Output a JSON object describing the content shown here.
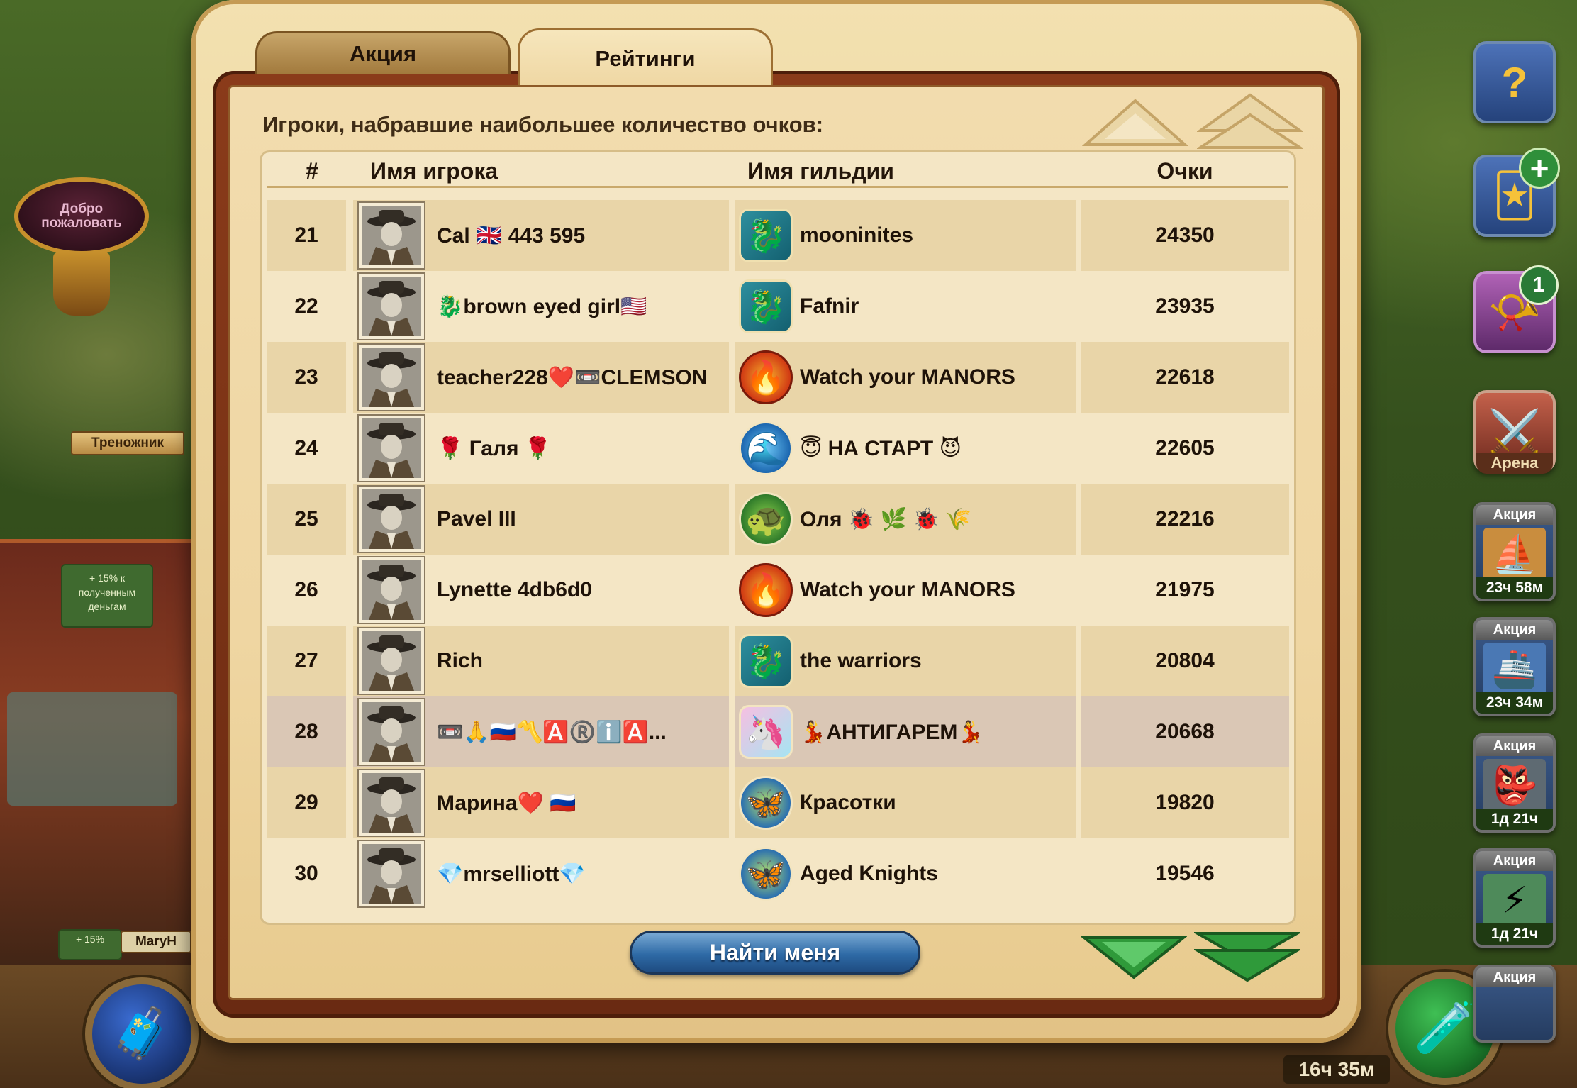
{
  "tabs": [
    {
      "label": "Акция",
      "active": false
    },
    {
      "label": "Рейтинги",
      "active": true
    }
  ],
  "header": "Игроки, набравшие наибольшее количество очков:",
  "columns": {
    "rank": "#",
    "player": "Имя игрока",
    "guild": "Имя гильдии",
    "points": "Очки"
  },
  "rows": [
    {
      "rank": "21",
      "player": "Cal 🇬🇧 443 595",
      "guild": "mooninites",
      "guild_icon": "dragon-emblem-icon",
      "points": "24350"
    },
    {
      "rank": "22",
      "player": "🐉brown eyed girl🇺🇸",
      "guild": "Fafnir",
      "guild_icon": "dragon-emblem-icon",
      "points": "23935"
    },
    {
      "rank": "23",
      "player": "teacher228❤️📼CLEMSON",
      "guild": "Watch your MANORS",
      "guild_icon": "phoenix-emblem-icon",
      "points": "22618"
    },
    {
      "rank": "24",
      "player": "🌹 Галя 🌹",
      "guild": "😇 НА СТАРТ 😈",
      "guild_icon": "wave-emblem-icon",
      "points": "22605"
    },
    {
      "rank": "25",
      "player": "Pavel III",
      "guild": "Оля 🐞 🌿 🐞 🌾",
      "guild_icon": "turtle-emblem-icon",
      "points": "22216"
    },
    {
      "rank": "26",
      "player": "Lynette 4db6d0",
      "guild": "Watch your MANORS",
      "guild_icon": "phoenix-emblem-icon",
      "points": "21975"
    },
    {
      "rank": "27",
      "player": "Rich",
      "guild": "the warriors",
      "guild_icon": "dragon-emblem-icon",
      "points": "20804"
    },
    {
      "rank": "28",
      "player": "📼🙏🇷🇺〽️🅰️®️ℹ️🅰️...",
      "guild": "💃АНТИГАРЕМ💃",
      "guild_icon": "unicorn-emblem-icon",
      "points": "20668"
    },
    {
      "rank": "29",
      "player": "Марина❤️ 🇷🇺",
      "guild": "Красотки",
      "guild_icon": "butterfly-emblem-icon",
      "points": "19820"
    },
    {
      "rank": "30",
      "player": "💎mrselliott💎",
      "guild": "Aged Knights",
      "guild_icon": "butterfly-emblem-icon",
      "points": "19546"
    }
  ],
  "highlighted_rank": "28",
  "find_me_label": "Найти меня",
  "background": {
    "welcome_sign": "Добро пожаловать",
    "map_label": "Треножник",
    "bonus_note": "+ 15% к полученным деньгам",
    "bonus_note_short": "+ 15%",
    "player_tag": "MaryH",
    "bottom_timer": "16ч 35м"
  },
  "side_buttons": {
    "help_icon": "question-icon",
    "quests_badge": "+",
    "horn_badge": "1",
    "arena_label": "Арена"
  },
  "promos": [
    {
      "title": "Акция",
      "timer": "23ч 58м"
    },
    {
      "title": "Акция",
      "timer": "23ч 34м"
    },
    {
      "title": "Акция",
      "timer": "1д 21ч"
    },
    {
      "title": "Акция",
      "timer": "1д 21ч"
    },
    {
      "title": "Акция",
      "timer": ""
    }
  ],
  "colors": {
    "parchment": "#efd6a2",
    "highlight_row": "#dac7b5",
    "find_button": "#2e6aa6",
    "arrow_green": "#2f9a3a"
  }
}
